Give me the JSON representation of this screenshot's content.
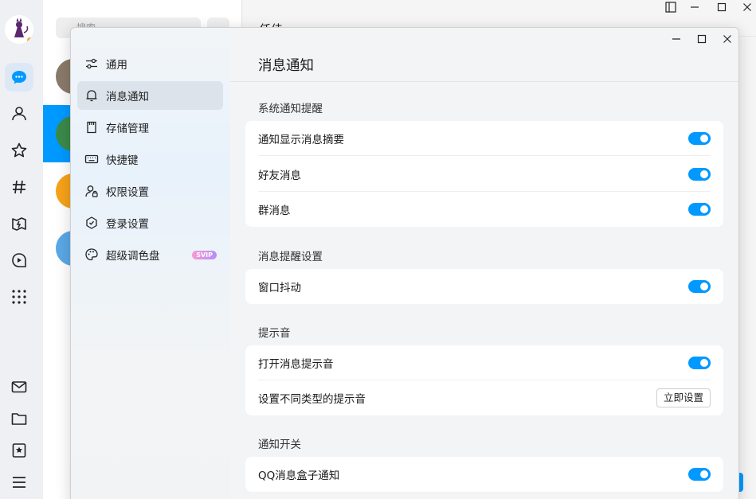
{
  "chat_list": {
    "search_placeholder": "搜索"
  },
  "chat_header": {
    "title": "任佳"
  },
  "settings": {
    "nav": [
      {
        "label": "通用",
        "icon": "sliders-icon"
      },
      {
        "label": "消息通知",
        "icon": "bell-icon",
        "active": true
      },
      {
        "label": "存储管理",
        "icon": "storage-icon"
      },
      {
        "label": "快捷键",
        "icon": "keyboard-icon"
      },
      {
        "label": "权限设置",
        "icon": "user-lock-icon"
      },
      {
        "label": "登录设置",
        "icon": "shield-hex-icon"
      },
      {
        "label": "超级调色盘",
        "icon": "palette-icon",
        "badge": "SVIP"
      }
    ],
    "page_title": "消息通知",
    "sections": [
      {
        "title": "系统通知提醒",
        "rows": [
          {
            "label": "通知显示消息摘要",
            "control": "toggle",
            "on": true
          },
          {
            "label": "好友消息",
            "control": "toggle",
            "on": true
          },
          {
            "label": "群消息",
            "control": "toggle",
            "on": true
          }
        ]
      },
      {
        "title": "消息提醒设置",
        "rows": [
          {
            "label": "窗口抖动",
            "control": "toggle",
            "on": true
          }
        ]
      },
      {
        "title": "提示音",
        "rows": [
          {
            "label": "打开消息提示音",
            "control": "toggle",
            "on": true
          },
          {
            "label": "设置不同类型的提示音",
            "control": "button",
            "button_label": "立即设置"
          }
        ]
      },
      {
        "title": "通知开关",
        "rows": [
          {
            "label": "QQ消息盒子通知",
            "control": "toggle",
            "on": true
          }
        ]
      }
    ]
  },
  "colors": {
    "accent": "#0099ff",
    "toggle_on": "#0099ff"
  }
}
